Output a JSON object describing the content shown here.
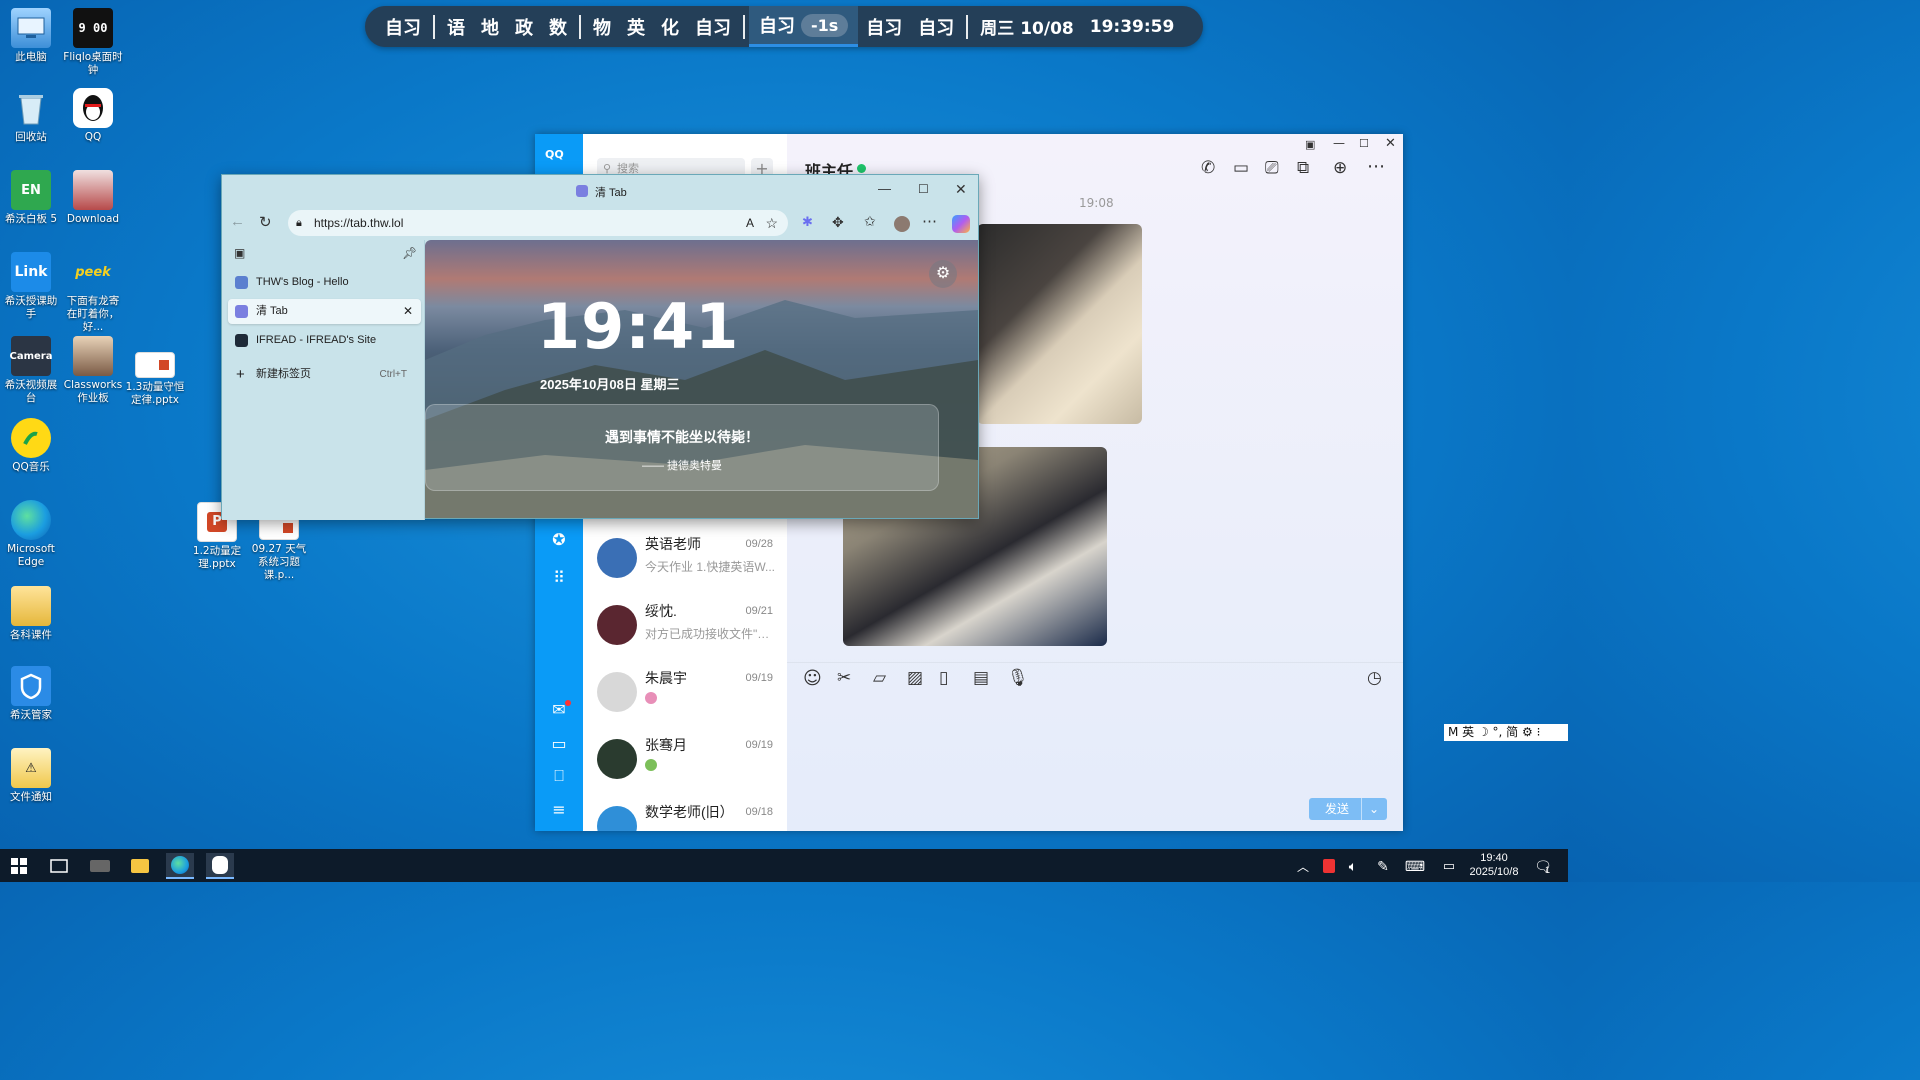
{
  "desktop": {
    "icons": [
      {
        "label": "此电脑",
        "icon": "computer-icon"
      },
      {
        "label": "Fliqlo桌面时钟",
        "icon": "clock-icon",
        "glyph": "9 00"
      },
      {
        "label": "回收站",
        "icon": "recycle-bin-icon"
      },
      {
        "label": "QQ",
        "icon": "qq-penguin-icon"
      },
      {
        "label": "希沃白板 5",
        "icon": "seewo-whiteboard-icon",
        "glyph": "EN"
      },
      {
        "label": "Download",
        "icon": "download-folder-icon"
      },
      {
        "label": "希沃授课助手",
        "icon": "seewo-link-icon",
        "glyph": "Link"
      },
      {
        "label": "下面有龙寄在盯着你，好...",
        "icon": "dragon-peek-icon",
        "glyph": "peek"
      },
      {
        "label": "希沃视频展台",
        "icon": "seewo-camera-icon",
        "glyph": "Camera"
      },
      {
        "label": "Classworks 作业板",
        "icon": "classworks-icon"
      },
      {
        "label": "1.3动量守恒定律.pptx",
        "icon": "pptx-file-icon"
      },
      {
        "label": "QQ音乐",
        "icon": "qq-music-icon"
      },
      {
        "label": "Microsoft Edge",
        "icon": "edge-icon"
      },
      {
        "label": "1.2动量定理.pptx",
        "icon": "pptx-file-icon"
      },
      {
        "label": "09.27 天气系统习题课.p...",
        "icon": "pptx-file-icon"
      },
      {
        "label": "各科课件",
        "icon": "courseware-folder-icon"
      },
      {
        "label": "希沃管家",
        "icon": "seewo-manager-icon"
      },
      {
        "label": "文件通知",
        "icon": "file-notice-icon"
      }
    ]
  },
  "schedule": {
    "groups": [
      [
        "自习"
      ],
      [
        "语",
        "地",
        "政",
        "数"
      ],
      [
        "物",
        "英",
        "化",
        "自习"
      ]
    ],
    "current": "自习",
    "offset": "-1s",
    "after": [
      "自习",
      "自习"
    ],
    "date": "周三 10/08",
    "time": "19:39:59"
  },
  "qq": {
    "logo": "QQ",
    "search_placeholder": "搜索",
    "chat_title": "班主任",
    "timestamp": "19:08",
    "send_label": "发送",
    "contacts": [
      {
        "name": "英语老师",
        "time": "09/28",
        "preview": "今天作业 1.快捷英语W...",
        "avatar_color": "#3a6fb5"
      },
      {
        "name": "绥忱.",
        "time": "09/21",
        "preview": "对方已成功接收文件\"09...",
        "avatar_color": "#5a2630"
      },
      {
        "name": "朱晨宇",
        "time": "09/19",
        "preview": "",
        "avatar_color": "#d8d8d8"
      },
      {
        "name": "张骞月",
        "time": "09/19",
        "preview": "",
        "avatar_color": "#2a3b2f"
      },
      {
        "name": "数学老师(旧）",
        "time": "09/18",
        "preview": "",
        "avatar_color": "#2f8fd8"
      }
    ]
  },
  "edge": {
    "window_title": "清 Tab",
    "url": "https://tab.thw.lol",
    "tabs": [
      {
        "label": "THW's Blog - Hello",
        "fav": "#5b7fcf",
        "active": false
      },
      {
        "label": "清 Tab",
        "fav": "#7a7fe0",
        "active": true
      },
      {
        "label": "IFREAD - IFREAD's Site",
        "fav": "#1e2a38",
        "active": false
      }
    ],
    "new_tab_label": "新建标签页",
    "new_tab_shortcut": "Ctrl+T",
    "clock": "19:41",
    "date_line": "2025年10月08日 星期三",
    "quote": "遇到事情不能坐以待毙！",
    "quote_author": "—— 捷德奥特曼"
  },
  "ime": {
    "text": "M 英 ☽ °, 简 ⚙ ⁝"
  },
  "taskbar": {
    "time": "19:40",
    "date": "2025/10/8",
    "notification_count": "1"
  }
}
